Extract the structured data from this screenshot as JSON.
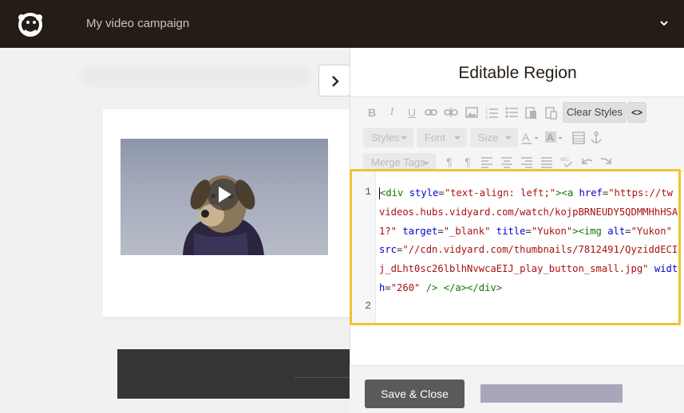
{
  "header": {
    "title": "My video campaign"
  },
  "panel": {
    "title": "Editable Region"
  },
  "toolbar": {
    "clear_styles_label": "Clear Styles",
    "code_toggle_label": "<>",
    "styles_label": "Styles",
    "font_label": "Font",
    "size_label": "Size",
    "merge_tags_label": "Merge Tags"
  },
  "editor": {
    "line_numbers": [
      "1",
      "2"
    ]
  },
  "footer": {
    "save_label": "Save & Close"
  },
  "colors": {
    "topbar": "#241c15",
    "highlight": "#f2c230",
    "save_button": "#5c5a59"
  }
}
